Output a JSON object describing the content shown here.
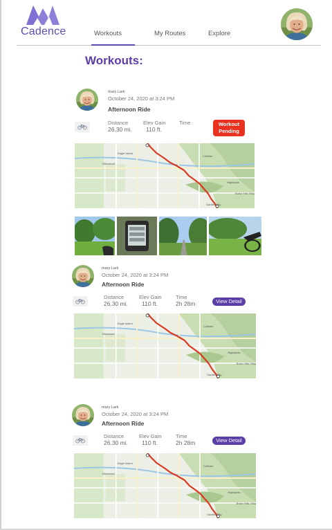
{
  "app": {
    "brand": "Cadence",
    "colors": {
      "accent": "#5b3ea6",
      "pending": "#e8311e",
      "route": "#d93a22"
    }
  },
  "nav": {
    "items": [
      {
        "label": "Workouts",
        "active": true
      },
      {
        "label": "My Routes",
        "active": false
      },
      {
        "label": "Explore",
        "active": false
      }
    ]
  },
  "page": {
    "title": "Workouts:"
  },
  "workouts": [
    {
      "user": "mary Lark",
      "date": "October 24, 2020 at 3:24 PM",
      "title": "Afternoon Ride",
      "activity_icon": "bike-icon",
      "stats": [
        {
          "label": "Distance",
          "value": "26.30 mi."
        },
        {
          "label": "Elev Gain",
          "value": "110 ft."
        },
        {
          "label": "Time",
          "value": ""
        }
      ],
      "button": "Workout Pending",
      "map_labels": [
        "Eagle Island",
        "Glenwood",
        "Collister",
        "Highlands",
        "Boise Hills Village",
        "Garden City"
      ],
      "photos": [
        "park-photo",
        "gps-computer-photo",
        "trail-photo",
        "bike-in-park-photo"
      ]
    },
    {
      "user": "mary Lark",
      "date": "October 24, 2020 at 3:24 PM",
      "title": "Afternoon Ride",
      "activity_icon": "bike-icon",
      "stats": [
        {
          "label": "Distance",
          "value": "26.30 mi."
        },
        {
          "label": "Elev Gain",
          "value": "110 ft."
        },
        {
          "label": "Time",
          "value": "2h 28m"
        }
      ],
      "button": "View Detail",
      "map_labels": [
        "Eagle Island",
        "Glenwood",
        "Collister",
        "Highlands",
        "Boise Hills Village",
        "Garden City"
      ]
    },
    {
      "user": "mary Lark",
      "date": "October 24, 2020 at 3:24 PM",
      "title": "Afternoon Ride",
      "activity_icon": "bike-icon",
      "stats": [
        {
          "label": "Distance",
          "value": "26.30 mi."
        },
        {
          "label": "Elev Gain",
          "value": "110 ft."
        },
        {
          "label": "Time",
          "value": "2h 28m"
        }
      ],
      "button": "View Detail",
      "map_labels": [
        "Eagle Island",
        "Glenwood",
        "Collister",
        "Highlands",
        "Boise Hills Village",
        "Garden City"
      ]
    }
  ]
}
